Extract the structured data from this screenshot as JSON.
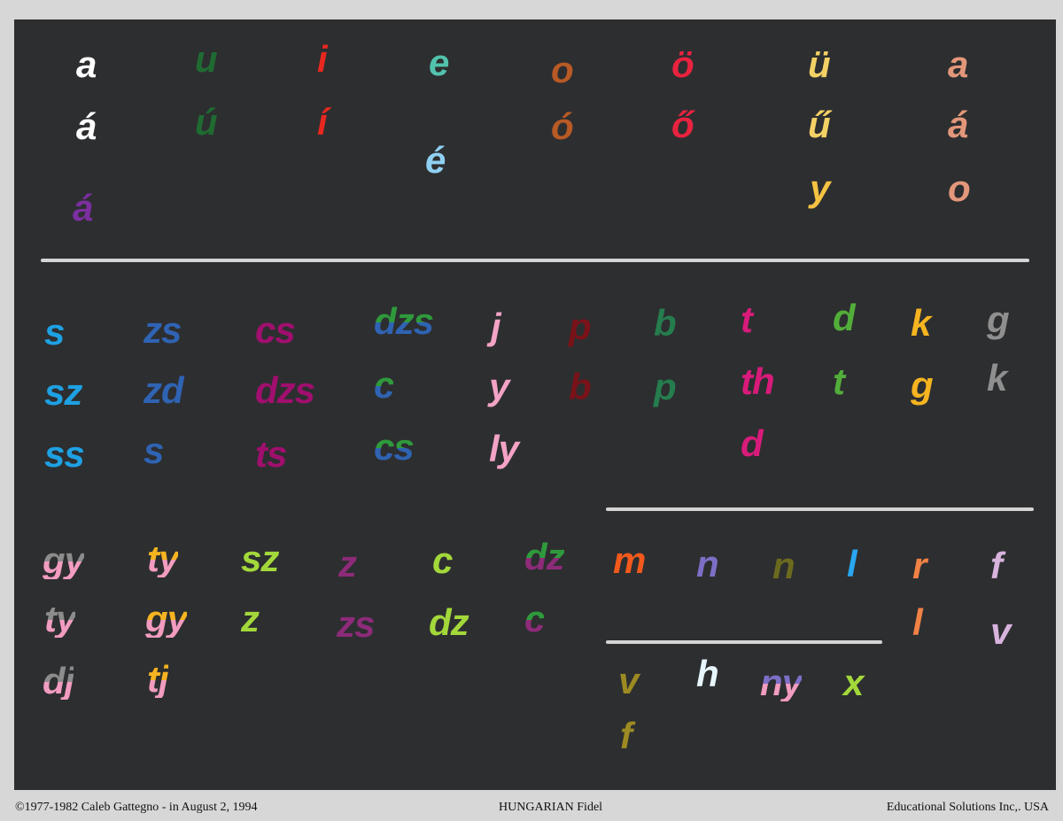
{
  "board": {
    "vowels": [
      {
        "text": "a",
        "color": "#ffffff"
      },
      {
        "text": "á",
        "color": "#ffffff"
      },
      {
        "text": "á",
        "color": "#7b2fa0"
      },
      {
        "text": "u",
        "color": "#1f6b32"
      },
      {
        "text": "ú",
        "color": "#1f6b32"
      },
      {
        "text": "i",
        "color": "#e8281f"
      },
      {
        "text": "í",
        "color": "#e8281f"
      },
      {
        "text": "e",
        "color": "#52c2ad"
      },
      {
        "text": "é",
        "color": "#8fd0f2"
      },
      {
        "text": "o",
        "color": "#b85a25"
      },
      {
        "text": "ó",
        "color": "#b85a25"
      },
      {
        "text": "ö",
        "color": "#e8233f"
      },
      {
        "text": "ő",
        "color": "#e8233f"
      },
      {
        "text": "ü",
        "color": "#f3d165"
      },
      {
        "text": "ű",
        "color": "#f3d165"
      },
      {
        "text": "y",
        "color": "#f5c242"
      },
      {
        "text": "a",
        "color": "#e3977a"
      },
      {
        "text": "á",
        "color": "#e3977a"
      },
      {
        "text": "o",
        "color": "#e3977a"
      }
    ],
    "consonants": [
      {
        "text": "s",
        "colors": [
          "#1ea1e3"
        ]
      },
      {
        "text": "sz",
        "colors": [
          "#1ea1e3"
        ]
      },
      {
        "text": "ss",
        "colors": [
          "#1ea1e3"
        ]
      },
      {
        "text": "zs",
        "colors": [
          "#2f63b3"
        ]
      },
      {
        "text": "zd",
        "colors": [
          "#2f63b3"
        ]
      },
      {
        "text": "s",
        "colors": [
          "#2f63b3"
        ]
      },
      {
        "text": "cs",
        "colors": [
          "#a00f6e"
        ]
      },
      {
        "text": "dzs",
        "colors": [
          "#a00f6e"
        ]
      },
      {
        "text": "ts",
        "colors": [
          "#a00f6e"
        ]
      },
      {
        "text": "dzs",
        "colors": [
          "#2f9a3c",
          "#2f63b3"
        ]
      },
      {
        "text": "c",
        "colors": [
          "#2f9a3c",
          "#2f63b3"
        ]
      },
      {
        "text": "cs",
        "colors": [
          "#2f9a3c",
          "#2f63b3"
        ]
      },
      {
        "text": "j",
        "colors": [
          "#f3a3c5"
        ]
      },
      {
        "text": "y",
        "colors": [
          "#f3a3c5"
        ]
      },
      {
        "text": "ly",
        "colors": [
          "#f3a3c5"
        ]
      },
      {
        "text": "p",
        "colors": [
          "#7a1219"
        ]
      },
      {
        "text": "b",
        "colors": [
          "#7a1219"
        ]
      },
      {
        "text": "b",
        "colors": [
          "#257d4e"
        ]
      },
      {
        "text": "p",
        "colors": [
          "#257d4e"
        ]
      },
      {
        "text": "t",
        "colors": [
          "#d81b7a"
        ]
      },
      {
        "text": "th",
        "colors": [
          "#d81b7a"
        ]
      },
      {
        "text": "d",
        "colors": [
          "#d81b7a"
        ]
      },
      {
        "text": "d",
        "colors": [
          "#52ae3a"
        ]
      },
      {
        "text": "t",
        "colors": [
          "#52ae3a"
        ]
      },
      {
        "text": "k",
        "colors": [
          "#f5b420"
        ]
      },
      {
        "text": "g",
        "colors": [
          "#f5b420"
        ]
      },
      {
        "text": "g",
        "colors": [
          "#8f8f8f"
        ]
      },
      {
        "text": "k",
        "colors": [
          "#8f8f8f"
        ]
      },
      {
        "text": "gy",
        "colors": [
          "#8c8c8c",
          "#f29cc0"
        ]
      },
      {
        "text": "ty",
        "colors": [
          "#8c8c8c",
          "#f29cc0"
        ]
      },
      {
        "text": "dj",
        "colors": [
          "#8c8c8c",
          "#f29cc0"
        ]
      },
      {
        "text": "ty",
        "colors": [
          "#f5b420",
          "#f29cc0"
        ]
      },
      {
        "text": "gy",
        "colors": [
          "#f5b420",
          "#f29cc0"
        ]
      },
      {
        "text": "tj",
        "colors": [
          "#f5b420",
          "#f29cc0"
        ]
      },
      {
        "text": "sz",
        "colors": [
          "#a3d83b"
        ]
      },
      {
        "text": "z",
        "colors": [
          "#a3d83b"
        ]
      },
      {
        "text": "z",
        "colors": [
          "#8d2b79"
        ]
      },
      {
        "text": "zs",
        "colors": [
          "#8d2b79"
        ]
      },
      {
        "text": "c",
        "colors": [
          "#a3d83b"
        ]
      },
      {
        "text": "dz",
        "colors": [
          "#a3d83b"
        ]
      },
      {
        "text": "dz",
        "colors": [
          "#2f9a3c",
          "#8d2b79"
        ]
      },
      {
        "text": "c",
        "colors": [
          "#2f9a3c",
          "#8d2b79"
        ]
      },
      {
        "text": "m",
        "colors": [
          "#f4591c"
        ]
      },
      {
        "text": "n",
        "colors": [
          "#7d6fc6"
        ]
      },
      {
        "text": "n",
        "colors": [
          "#6c6a1f"
        ]
      },
      {
        "text": "l",
        "colors": [
          "#29a7f0"
        ]
      },
      {
        "text": "r",
        "colors": [
          "#f08245"
        ]
      },
      {
        "text": "l",
        "colors": [
          "#f08245"
        ]
      },
      {
        "text": "f",
        "colors": [
          "#d8b3de"
        ]
      },
      {
        "text": "v",
        "colors": [
          "#d8b3de"
        ]
      },
      {
        "text": "v",
        "colors": [
          "#9c8a22"
        ]
      },
      {
        "text": "f",
        "colors": [
          "#9c8a22"
        ]
      },
      {
        "text": "h",
        "colors": [
          "#e7f6fd"
        ]
      },
      {
        "text": "ny",
        "colors": [
          "#7d6fc6",
          "#f29cc0"
        ]
      },
      {
        "text": "x",
        "colors": [
          "#a3d83b"
        ]
      }
    ]
  },
  "footer": {
    "copyright": "©1977-1982 Caleb Gattegno - in August 2, 1994",
    "title": "HUNGARIAN Fidel",
    "publisher": "Educational Solutions Inc,. USA"
  }
}
